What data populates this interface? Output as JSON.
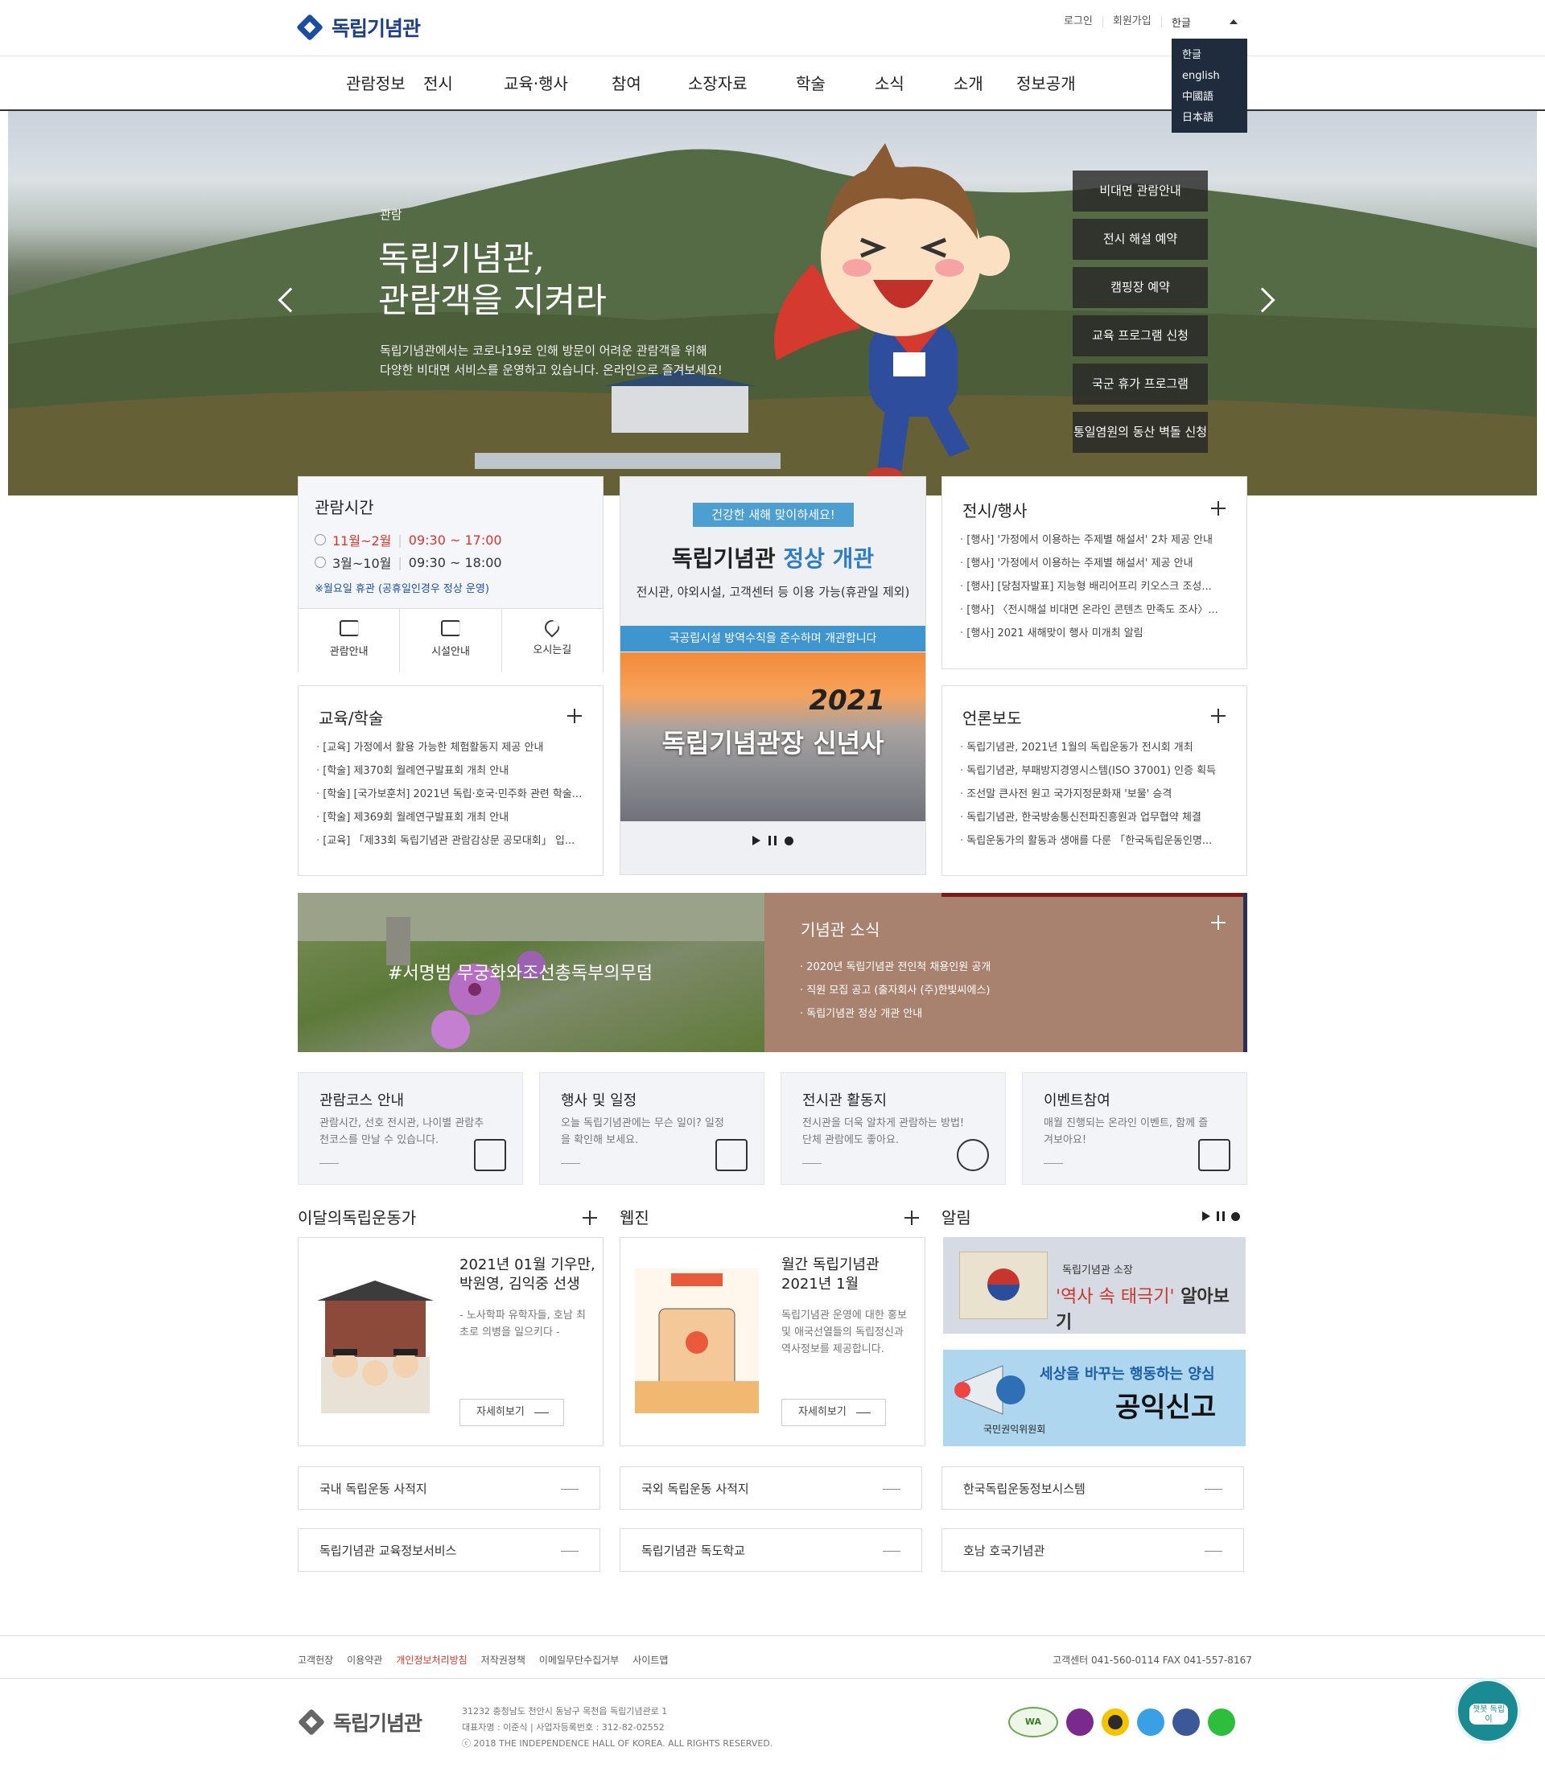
{
  "header": {
    "logo_text": "독립기념관",
    "util": [
      "로그인",
      "회원가입"
    ],
    "lang_current": "한글",
    "lang_options": [
      "한글",
      "english",
      "中國語",
      "日本語"
    ]
  },
  "gnb": [
    "관람정보",
    "전시",
    "교육·행사",
    "참여",
    "소장자료",
    "학술",
    "소식",
    "소개",
    "정보공개"
  ],
  "hero": {
    "sub": "관람",
    "title_line1": "독립기념관,",
    "title_line2": "관람객을 지켜라",
    "desc_line1": "독립기념관에서는 코로나19로 인해 방문이 어려운 관람객을 위해",
    "desc_line2": "다양한 비대면 서비스를 운영하고 있습니다. 온라인으로 즐겨보세요!",
    "quick": [
      "비대면 관람안내",
      "전시 해설 예약",
      "캠핑장 예약",
      "교육 프로그램 신청",
      "국군 휴가 프로그램",
      "통일염원의 동산 벽돌 신청"
    ]
  },
  "hours": {
    "title": "관람시간",
    "row1_period": "11월~2월",
    "row1_time": "09:30 ~ 17:00",
    "row2_period": "3월~10월",
    "row2_time": "09:30 ~ 18:00",
    "note": "※월요일 휴관 (공휴일인경우 정상 운영)",
    "links": [
      "관람안내",
      "시설안내",
      "오시는길"
    ]
  },
  "popup": {
    "badge": "건강한 새해 맞이하세요!",
    "title_a": "독립기념관",
    "title_b": " 정상 개관",
    "sub": "전시관, 야외시설, 고객센터 등 이용 가능(휴관일 제외)",
    "strip": "국공립시설 방역수칙을 준수하며 개관합니다",
    "year": "2021",
    "ny": "독립기념관장 신년사"
  },
  "exhib": {
    "title": "전시/행사",
    "items": [
      "[행사] '가정에서 이용하는 주제별 해설서' 2차 제공 안내",
      "[행사] '가정에서 이용하는 주제별 해설서' 제공 안내",
      "[행사] [당첨자발표] 지능형 배리어프리 키오스크 조성...",
      "[행사] 〈전시해설 비대면 온라인 콘텐츠 만족도 조사〉...",
      "[행사] 2021 새해맞이 행사 미개최 알림"
    ]
  },
  "edu": {
    "title": "교육/학술",
    "items": [
      "[교육] 가정에서 활용 가능한 체험활동지 제공 안내",
      "[학술] 제370회 월례연구발표회 개최 안내",
      "[학술] [국가보훈처] 2021년 독립·호국·민주화 관련 학술...",
      "[학술] 제369회 월례연구발표회 개최 안내",
      "[교육] 「제33회 독립기념관 관람감상문 공모대회」 입..."
    ]
  },
  "press": {
    "title": "언론보도",
    "items": [
      "독립기념관, 2021년 1월의 독립운동가 전시회 개최",
      "독립기념관, 부패방지경영시스템(ISO 37001) 인증 획득",
      "조선말 큰사전 원고 국가지정문화재 '보물' 승격",
      "독립기념관, 한국방송통신전파진흥원과 업무협약 체결",
      "독립운동가의 활동과 생애를 다룬 「한국독립운동인명..."
    ]
  },
  "photo_banner": {
    "caption": "#서명범 무궁화와조선총독부의무덤"
  },
  "news_banner": {
    "title": "기념관 소식",
    "items": [
      "2020년 독립기념관 전인척 채용인원 공개",
      "직원 모집 공고 (출자회사 (주)한빛씨에스)",
      "독립기념관 정상 개관 안내"
    ]
  },
  "services": [
    {
      "title": "관람코스 안내",
      "desc": "관람시간, 선호 전시관, 나이별 관람추천코스를 만날 수 있습니다.",
      "icon": "map-pin-icon"
    },
    {
      "title": "행사 및 일정",
      "desc": "오늘 독립기념관에는 무슨 일이? 일정을 확인해 보세요.",
      "icon": "schedule-icon"
    },
    {
      "title": "전시관 활동지",
      "desc": "전시관을 더욱 알차게 관람하는 방법! 단체 관람에도 좋아요.",
      "icon": "face-icon"
    },
    {
      "title": "이벤트참여",
      "desc": "매월 진행되는 온라인 이벤트, 함께 즐겨보아요!",
      "icon": "gift-icon"
    }
  ],
  "monthly": {
    "section": "이달의독립운동가",
    "title": "2021년 01월 기우만, 박원영, 김익중 선생",
    "desc": "- 노사학파 유학자들, 호남 최초로 의병을 일으키다 -",
    "more": "자세히보기"
  },
  "webzine": {
    "section": "웹진",
    "title": "월간 독립기념관 2021년 1월",
    "desc": "독립기념관 운영에 대한 홍보 및 애국선열들의 독립정신과 역사정보를 제공합니다.",
    "more": "자세히보기"
  },
  "alim": {
    "section": "알림",
    "b1_small": "독립기념관 소장",
    "b1_big_a": "'역사 속 태극기'",
    "b1_big_b": " 알아보기",
    "b2_small": "세상을 바꾸는 행동하는 양심",
    "b2_big": "공익신고",
    "b2_org": "국민권익위원회"
  },
  "links": [
    "국내 독립운동 사적지",
    "국외 독립운동 사적지",
    "한국독립운동정보시스템",
    "독립기념관 교육정보서비스",
    "독립기념관 독도학교",
    "호남 호국기념관"
  ],
  "footer": {
    "links": [
      "고객헌장",
      "이용약관",
      "개인정보처리방침",
      "저작권정책",
      "이메일무단수집거부",
      "사이트맵"
    ],
    "contact": "고객센터 041-560-0114     FAX 041-557-8167",
    "addr1": "31232 충청남도 천안시 동남구 목천읍 독립기념관로 1",
    "addr2": "대표자명 : 이준식  |  사업자등록번호 : 312-82-02552",
    "addr3": "ⓒ 2018 THE INDEPENDENCE HALL OF KOREA. ALL RIGHTS RESERVED.",
    "wa": "WA",
    "chat": "챗봇 독립이"
  },
  "colors": {
    "brand": "#1d4e9e",
    "accent_red": "#d8362b",
    "news_banner": "#a9826f"
  }
}
